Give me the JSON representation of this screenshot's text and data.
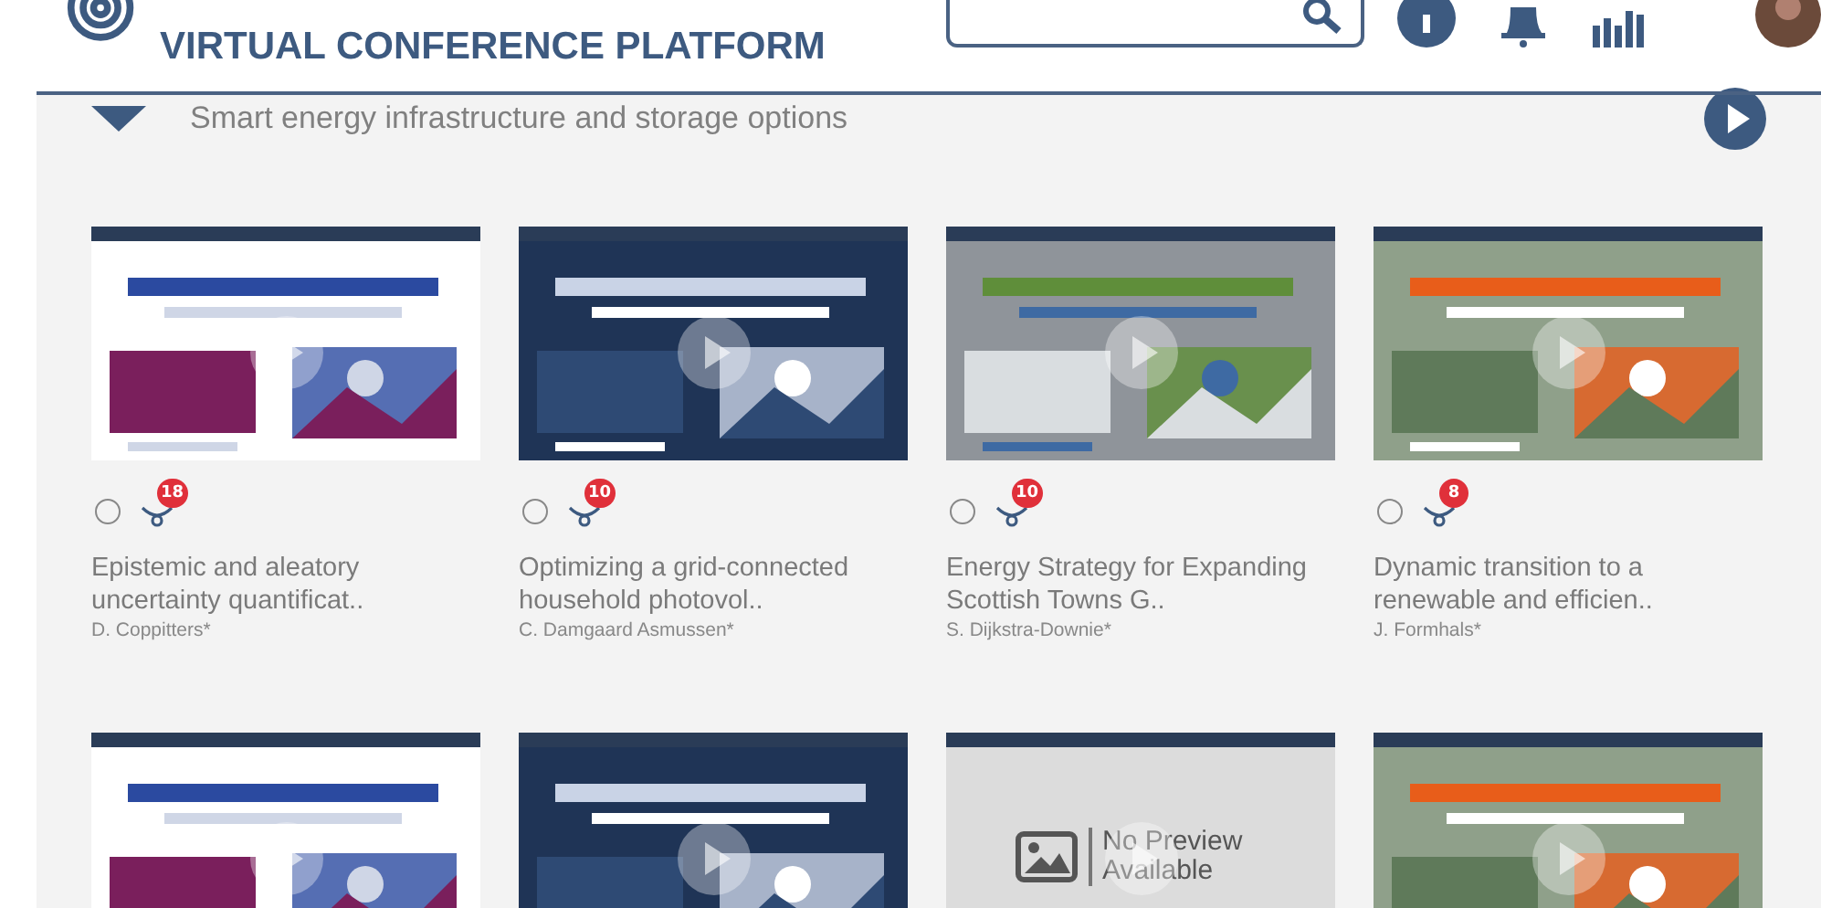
{
  "header": {
    "title": "VIRTUAL CONFERENCE PLATFORM"
  },
  "section": {
    "title": "Smart energy infrastructure and storage options",
    "expanded": true
  },
  "cards": [
    {
      "kind": "video",
      "selected": false,
      "comments": "18",
      "title": "Epistemic and aleatory uncertainty quantificat..",
      "author": "D. Coppitters*"
    },
    {
      "kind": "video",
      "selected": false,
      "comments": "10",
      "title": "Optimizing a grid-connected household photovol..",
      "author": "C. Damgaard Asmussen*"
    },
    {
      "kind": "video",
      "selected": false,
      "comments": "10",
      "title": "Energy Strategy for Expanding Scottish Towns G..",
      "author": "S. Dijkstra-Downie*"
    },
    {
      "kind": "video",
      "selected": false,
      "comments": "8",
      "title": "Dynamic transition to a renewable and efficien..",
      "author": "J. Formhals*"
    },
    {
      "kind": "video"
    },
    {
      "kind": "video"
    },
    {
      "kind": "placeholder",
      "placeholder_text": "No Preview Available"
    },
    {
      "kind": "video"
    }
  ]
}
